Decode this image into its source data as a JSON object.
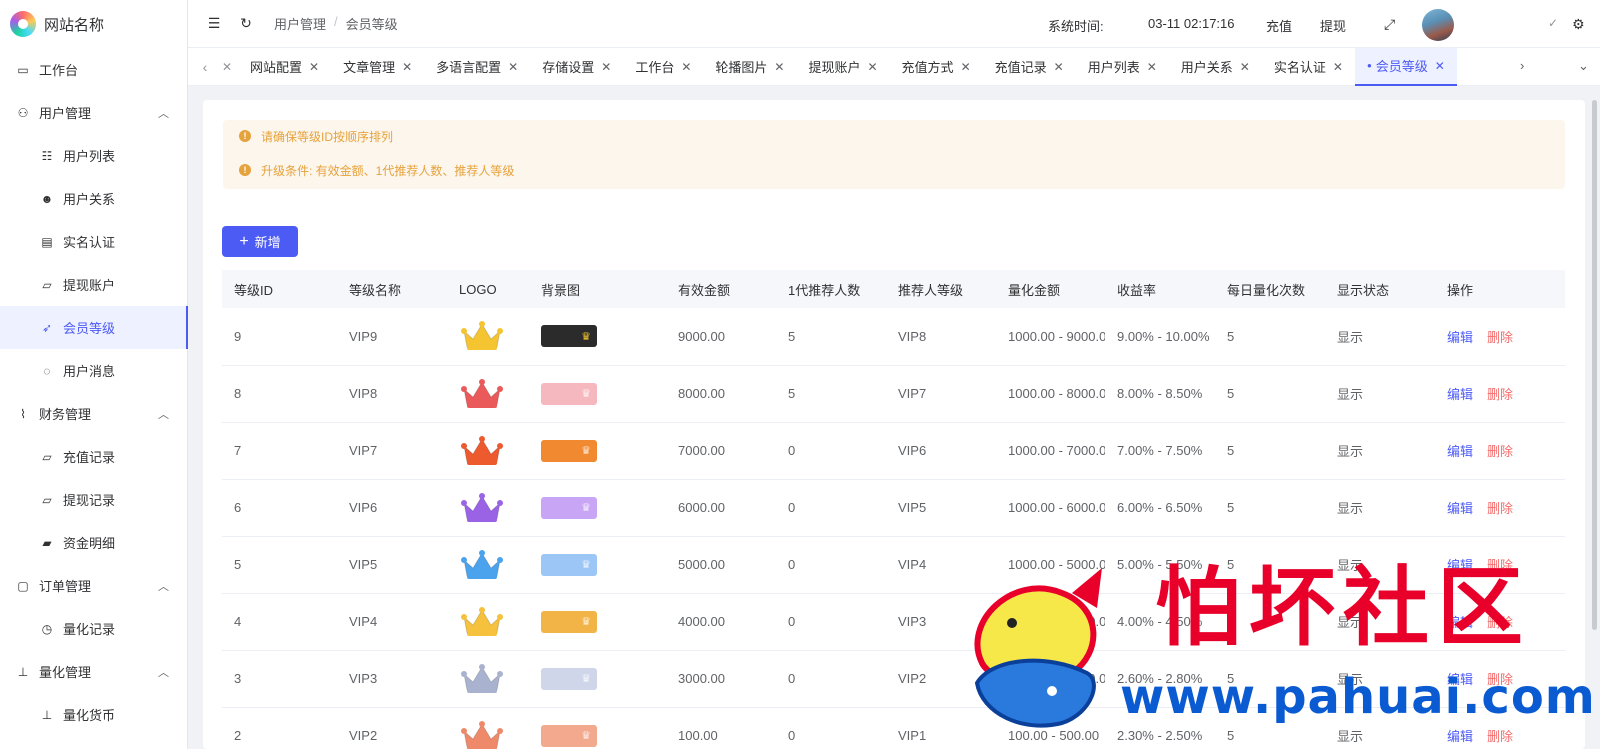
{
  "brand": {
    "name": "网站名称"
  },
  "sidebar": {
    "items": [
      {
        "label": "工作台",
        "icon": "monitor-icon",
        "level": 1
      },
      {
        "label": "用户管理",
        "icon": "user-icon",
        "level": 1,
        "expandable": true
      },
      {
        "label": "用户列表",
        "icon": "user-list-icon",
        "level": 2
      },
      {
        "label": "用户关系",
        "icon": "users-icon",
        "level": 2
      },
      {
        "label": "实名认证",
        "icon": "id-card-icon",
        "level": 2
      },
      {
        "label": "提现账户",
        "icon": "folder-icon",
        "level": 2
      },
      {
        "label": "会员等级",
        "icon": "rocket-icon",
        "level": 2,
        "active": true
      },
      {
        "label": "用户消息",
        "icon": "chat-icon",
        "level": 2
      },
      {
        "label": "财务管理",
        "icon": "chart-icon",
        "level": 1,
        "expandable": true
      },
      {
        "label": "充值记录",
        "icon": "folder-icon",
        "level": 2
      },
      {
        "label": "提现记录",
        "icon": "folder-icon",
        "level": 2
      },
      {
        "label": "资金明细",
        "icon": "wallet-icon",
        "level": 2
      },
      {
        "label": "订单管理",
        "icon": "document-icon",
        "level": 1,
        "expandable": true
      },
      {
        "label": "量化记录",
        "icon": "clock-icon",
        "level": 2
      },
      {
        "label": "量化管理",
        "icon": "quant-icon",
        "level": 1,
        "expandable": true
      },
      {
        "label": "量化货币",
        "icon": "quant-icon",
        "level": 2
      }
    ]
  },
  "header": {
    "breadcrumb": [
      "用户管理",
      "会员等级"
    ],
    "systime_label": "系统时间:",
    "systime": "03-11 02:17:16",
    "recharge": "充值",
    "withdraw": "提现",
    "check": "✓"
  },
  "tabs": [
    {
      "label": "网站配置"
    },
    {
      "label": "文章管理"
    },
    {
      "label": "多语言配置"
    },
    {
      "label": "存储设置"
    },
    {
      "label": "工作台"
    },
    {
      "label": "轮播图片"
    },
    {
      "label": "提现账户"
    },
    {
      "label": "充值方式"
    },
    {
      "label": "充值记录"
    },
    {
      "label": "用户列表"
    },
    {
      "label": "用户关系"
    },
    {
      "label": "实名认证"
    },
    {
      "label": "会员等级",
      "active": true
    }
  ],
  "alerts": [
    "请确保等级ID按顺序排列",
    "升级条件: 有效金额、1代推荐人数、推荐人等级"
  ],
  "add_button": "新增",
  "table": {
    "columns": [
      "等级ID",
      "等级名称",
      "LOGO",
      "背景图",
      "有效金额",
      "1代推荐人数",
      "推荐人等级",
      "量化金额",
      "收益率",
      "每日量化次数",
      "显示状态",
      "操作"
    ],
    "edit_label": "编辑",
    "delete_label": "删除",
    "rows": [
      {
        "id": "9",
        "name": "VIP9",
        "crown": "#f5c431",
        "bg": "#2b2b2b",
        "amount": "9000.00",
        "refs": "5",
        "ref_level": "VIP8",
        "quant": "1000.00 - 9000.0",
        "rate": "9.00% - 10.00%",
        "times": "5",
        "status": "显示"
      },
      {
        "id": "8",
        "name": "VIP8",
        "crown": "#ea5a5a",
        "bg": "#f6b8bf",
        "amount": "8000.00",
        "refs": "5",
        "ref_level": "VIP7",
        "quant": "1000.00 - 8000.0",
        "rate": "8.00% - 8.50%",
        "times": "5",
        "status": "显示"
      },
      {
        "id": "7",
        "name": "VIP7",
        "crown": "#ec5a2e",
        "bg": "#f0892f",
        "amount": "7000.00",
        "refs": "0",
        "ref_level": "VIP6",
        "quant": "1000.00 - 7000.0",
        "rate": "7.00% - 7.50%",
        "times": "5",
        "status": "显示"
      },
      {
        "id": "6",
        "name": "VIP6",
        "crown": "#9a63e6",
        "bg": "#c9a5f5",
        "amount": "6000.00",
        "refs": "0",
        "ref_level": "VIP5",
        "quant": "1000.00 - 6000.0",
        "rate": "6.00% - 6.50%",
        "times": "5",
        "status": "显示"
      },
      {
        "id": "5",
        "name": "VIP5",
        "crown": "#4ba3ee",
        "bg": "#9cc6f5",
        "amount": "5000.00",
        "refs": "0",
        "ref_level": "VIP4",
        "quant": "1000.00 - 5000.0",
        "rate": "5.00% - 5.50%",
        "times": "5",
        "status": "显示"
      },
      {
        "id": "4",
        "name": "VIP4",
        "crown": "#f6c13c",
        "bg": "#f2b446",
        "amount": "4000.00",
        "refs": "0",
        "ref_level": "VIP3",
        "quant": "1000.00 - 4000.0",
        "rate": "4.00% - 4.50%",
        "times": "5",
        "status": "显示"
      },
      {
        "id": "3",
        "name": "VIP3",
        "crown": "#a9b3cf",
        "bg": "#cfd6ea",
        "amount": "3000.00",
        "refs": "0",
        "ref_level": "VIP2",
        "quant": "1000.00 - 3000.0",
        "rate": "2.60% - 2.80%",
        "times": "5",
        "status": "显示"
      },
      {
        "id": "2",
        "name": "VIP2",
        "crown": "#ee8a6a",
        "bg": "#f2a98e",
        "amount": "100.00",
        "refs": "0",
        "ref_level": "VIP1",
        "quant": "100.00 - 500.00",
        "rate": "2.30% - 2.50%",
        "times": "5",
        "status": "显示"
      }
    ]
  },
  "watermark": {
    "text": "怕坏社区",
    "url": "www.pahuai.com"
  }
}
